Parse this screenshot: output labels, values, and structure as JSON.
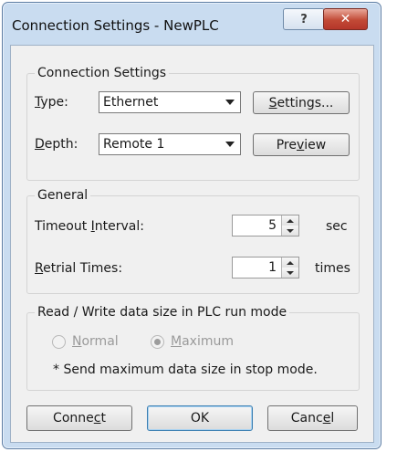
{
  "window": {
    "title": "Connection Settings - NewPLC",
    "help_glyph": "?",
    "close_glyph": "✕"
  },
  "connection": {
    "group_label": "Connection Settings",
    "type_label_pre": "",
    "type_label_u": "T",
    "type_label_post": "ype:",
    "type_value": "Ethernet",
    "settings_button_pre": "",
    "settings_button_u": "S",
    "settings_button_post": "ettings...",
    "depth_label_pre": "",
    "depth_label_u": "D",
    "depth_label_post": "epth:",
    "depth_value": "Remote 1",
    "preview_button_pre": "Pre",
    "preview_button_u": "v",
    "preview_button_post": "iew"
  },
  "general": {
    "group_label": "General",
    "timeout_label_pre": "Timeout ",
    "timeout_label_u": "I",
    "timeout_label_post": "nterval:",
    "timeout_value": "5",
    "timeout_unit": "sec",
    "retrial_label_pre": "",
    "retrial_label_u": "R",
    "retrial_label_post": "etrial Times:",
    "retrial_value": "1",
    "retrial_unit": "times"
  },
  "readwrite": {
    "group_label": "Read / Write data size in PLC run mode",
    "normal_label_pre": "",
    "normal_label_u": "N",
    "normal_label_post": "ormal",
    "maximum_label_pre": "",
    "maximum_label_u": "M",
    "maximum_label_post": "aximum",
    "selected": "Maximum",
    "note": "* Send maximum data size in stop mode."
  },
  "buttons": {
    "connect_pre": "Conne",
    "connect_u": "c",
    "connect_post": "t",
    "ok": "OK",
    "cancel_pre": "Canc",
    "cancel_u": "e",
    "cancel_post": "l"
  },
  "colors": {
    "frame": "#c9dcf0",
    "client": "#f0f0f0",
    "close_button": "#c24a36",
    "default_button_border": "#3c7fb1"
  }
}
